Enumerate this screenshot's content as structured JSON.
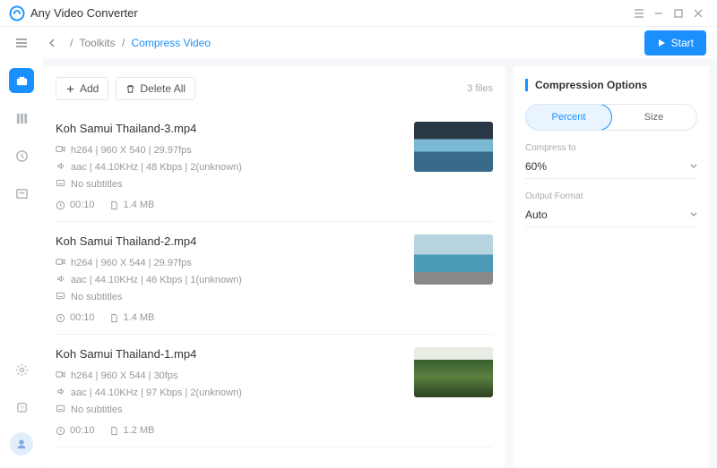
{
  "app": {
    "title": "Any Video Converter"
  },
  "breadcrumb": {
    "root": "Toolkits",
    "current": "Compress Video"
  },
  "startLabel": "Start",
  "buttons": {
    "add": "Add",
    "deleteAll": "Delete All"
  },
  "fileCount": "3 files",
  "files": [
    {
      "name": "Koh Samui Thailand-3.mp4",
      "video": "h264 | 960 X 540 | 29.97fps",
      "audio": "aac | 44.10KHz | 48 Kbps | 2(unknown)",
      "subs": "No subtitles",
      "duration": "00:10",
      "size": "1.4 MB",
      "thumbClass": "t1"
    },
    {
      "name": "Koh Samui Thailand-2.mp4",
      "video": "h264 | 960 X 544 | 29.97fps",
      "audio": "aac | 44.10KHz | 46 Kbps | 1(unknown)",
      "subs": "No subtitles",
      "duration": "00:10",
      "size": "1.4 MB",
      "thumbClass": "t2"
    },
    {
      "name": "Koh Samui Thailand-1.mp4",
      "video": "h264 | 960 X 544 | 30fps",
      "audio": "aac | 44.10KHz | 97 Kbps | 2(unknown)",
      "subs": "No subtitles",
      "duration": "00:10",
      "size": "1.2 MB",
      "thumbClass": "t3"
    }
  ],
  "options": {
    "title": "Compression Options",
    "tabPercent": "Percent",
    "tabSize": "Size",
    "compressToLabel": "Compress to",
    "compressToValue": "60%",
    "outputFormatLabel": "Output Format",
    "outputFormatValue": "Auto"
  }
}
